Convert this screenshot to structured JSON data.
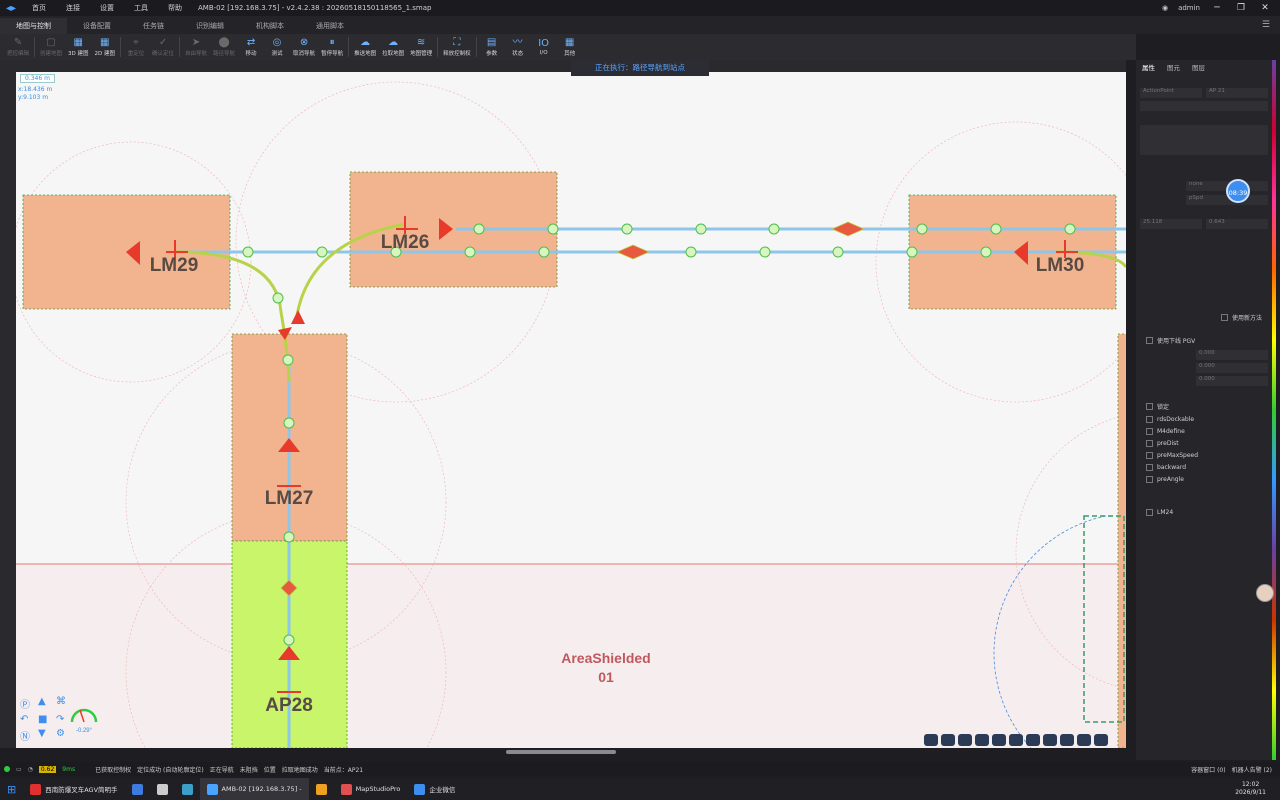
{
  "app": {
    "menu": [
      "首页",
      "连接",
      "设置",
      "工具",
      "帮助"
    ],
    "title": "AMB-02 [192.168.3.75] - v2.4.2.38 : 20260518150118565_1.smap",
    "user": "admin",
    "window_controls": [
      "─",
      "❐",
      "✕"
    ]
  },
  "tabs": [
    {
      "label": "地图与控制",
      "active": true
    },
    {
      "label": "设备配置",
      "active": false
    },
    {
      "label": "任务链",
      "active": false
    },
    {
      "label": "识别编辑",
      "active": false
    },
    {
      "label": "机构脚本",
      "active": false
    },
    {
      "label": "通用脚本",
      "active": false
    }
  ],
  "toolbar": [
    {
      "icon": "✎",
      "label": "把控编辑",
      "disabled": true
    },
    {
      "sep": true
    },
    {
      "icon": "▢",
      "label": "创建地图",
      "disabled": true
    },
    {
      "icon": "▦",
      "label": "3D 建图",
      "disabled": false
    },
    {
      "icon": "▦",
      "label": "2D 建图",
      "disabled": false
    },
    {
      "sep": true
    },
    {
      "icon": "⌖",
      "label": "重定位",
      "disabled": true
    },
    {
      "icon": "✓",
      "label": "确认定位",
      "disabled": true
    },
    {
      "sep": true
    },
    {
      "icon": "➤",
      "label": "自由导航",
      "disabled": true
    },
    {
      "icon": "⬤",
      "label": "路径导航",
      "disabled": true
    },
    {
      "icon": "⇄",
      "label": "移动",
      "disabled": false
    },
    {
      "icon": "◎",
      "label": "测试",
      "disabled": false
    },
    {
      "icon": "⊗",
      "label": "取消导航",
      "disabled": false
    },
    {
      "icon": "⏸",
      "label": "暂停导航",
      "disabled": false
    },
    {
      "sep": true
    },
    {
      "icon": "☁",
      "label": "推送地图",
      "disabled": false
    },
    {
      "icon": "☁",
      "label": "拉取地图",
      "disabled": false
    },
    {
      "icon": "≋",
      "label": "地图管理",
      "disabled": false
    },
    {
      "sep": true
    },
    {
      "icon": "⛶",
      "label": "释放控制权",
      "disabled": false
    },
    {
      "sep": true
    },
    {
      "icon": "▤",
      "label": "参数",
      "disabled": false
    },
    {
      "icon": "〰",
      "label": "状态",
      "disabled": false
    },
    {
      "icon": "IO",
      "label": "I/O",
      "disabled": false
    },
    {
      "icon": "▦",
      "label": "其他",
      "disabled": false
    }
  ],
  "exec_banner": "正在执行：路径导航到站点",
  "coords": {
    "scale": "0.346 m",
    "x": "x:18.436 m",
    "y": "y:9.103 m"
  },
  "map": {
    "labels": [
      "LM29",
      "LM26",
      "LM30",
      "LM27",
      "AP28"
    ],
    "area_label_1": "AreaShielded",
    "area_label_2": "01",
    "node_letter": "R",
    "gauge": "-0.29°",
    "colors": {
      "station": "#f2b48e",
      "ap": "#c8f56a",
      "path": "#8ec6ea",
      "curve": "#b8d24a",
      "arrow": "#e83a2a",
      "shield": "#e8a0a0"
    }
  },
  "right_panel": {
    "tabs": [
      {
        "label": "属性",
        "on": true
      },
      {
        "label": "图元",
        "on": false
      },
      {
        "label": "图层",
        "on": false
      }
    ],
    "fields": [
      "ActionPoint",
      "AP 21",
      "none",
      "pSpd",
      "25.118",
      "0.643",
      "使用新方法",
      "使用下线 PGV",
      "0.000",
      "0.000",
      "0.000"
    ],
    "checkboxes": [
      "锁定",
      "rdsDockable",
      "M4define",
      "preDist",
      "preMaxSpeed",
      "backward",
      "preAngle"
    ],
    "linked": "LM24",
    "bubble_time": "08:39"
  },
  "status": {
    "speed": "0.62",
    "ms": "9ms",
    "items": [
      "已获取控制权",
      "定位成功 (自动轮廓定位)",
      "正在导航",
      "未阻挡",
      "位置",
      "拉取地图成功",
      "当前点：AP21"
    ],
    "right_1": "容器窗口 (0)",
    "right_2": "机器人告警 (2)"
  },
  "taskbar": {
    "items": [
      {
        "label": "西南防爆叉车AGV简明手",
        "color": "#e03030",
        "active": false
      },
      {
        "label": "",
        "color": "#3d7be0",
        "active": false
      },
      {
        "label": "",
        "color": "#cccccc",
        "active": false
      },
      {
        "label": "",
        "color": "#3aa0c8",
        "active": false
      },
      {
        "label": "AMB-02 [192.168.3.75] -",
        "color": "#4aa3ff",
        "active": true
      },
      {
        "label": "",
        "color": "#f0a020",
        "active": false
      },
      {
        "label": "MapStudioPro",
        "color": "#e05050",
        "active": false
      },
      {
        "label": "企业微信",
        "color": "#3d8ef0",
        "active": false
      }
    ],
    "time": "12:02",
    "date": "2026/9/11"
  }
}
